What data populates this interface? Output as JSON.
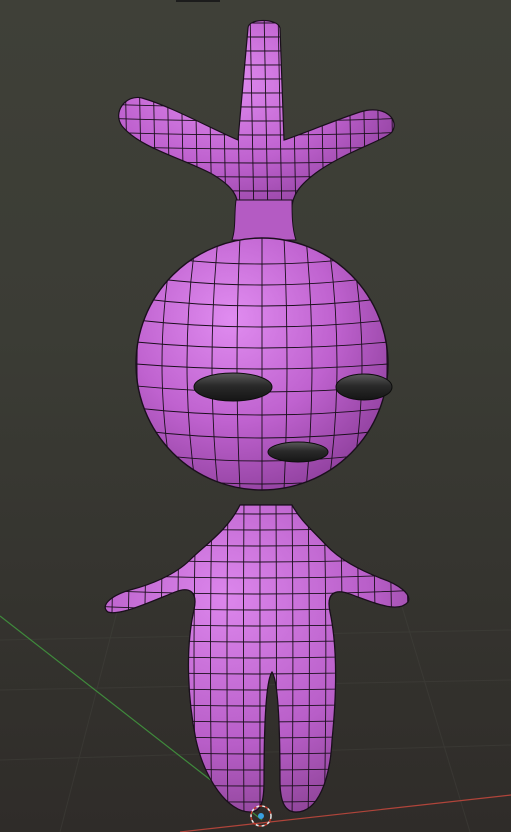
{
  "viewport": {
    "view": "3D viewport",
    "mode": "wireframe-overlay",
    "colors": {
      "background_top": "#3f4038",
      "background_bottom": "#2f2c29",
      "mesh_fill": "#b75ec6",
      "mesh_highlight": "#d77fe6",
      "mesh_edge": "#1a0f1c",
      "eye": "#2a2a2a",
      "x_axis": "#b0443a",
      "y_axis": "#3f8a3c",
      "grid": "#4a4a44"
    }
  },
  "model": {
    "name": "purple-character",
    "parts": [
      "antenna-center",
      "antenna-left",
      "antenna-right",
      "head",
      "left-eye",
      "right-eye",
      "mouth",
      "torso",
      "left-arm",
      "right-arm",
      "left-leg",
      "right-leg"
    ]
  },
  "scene": {
    "origin_icon": "3d-cursor-icon"
  }
}
